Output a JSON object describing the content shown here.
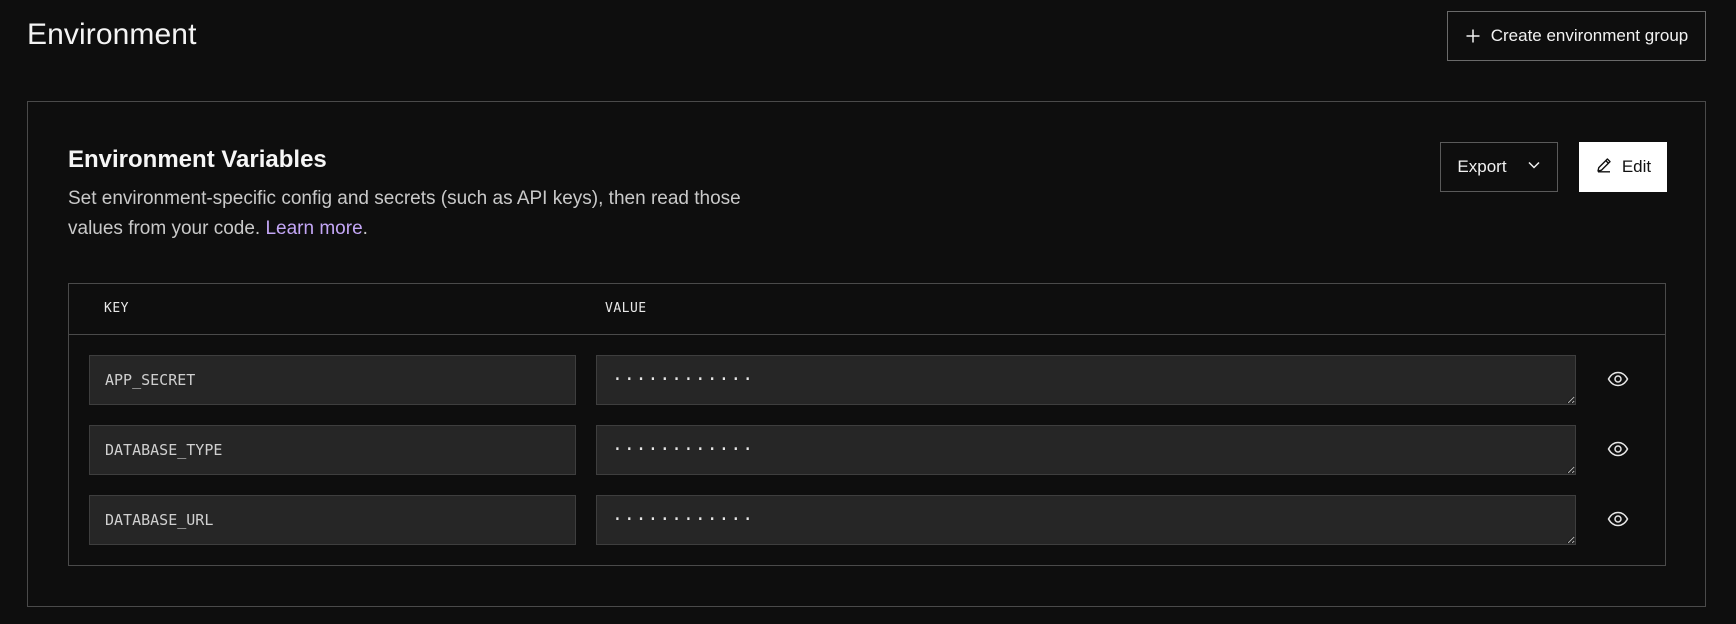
{
  "header": {
    "title": "Environment",
    "create_group_label": "Create environment group"
  },
  "card": {
    "title": "Environment Variables",
    "description": "Set environment-specific config and secrets (such as API keys), then read those values from your code.",
    "learn_more": "Learn more",
    "trailing": ".",
    "export_label": "Export",
    "edit_label": "Edit"
  },
  "table": {
    "columns": [
      "KEY",
      "VALUE"
    ],
    "rows": [
      {
        "key": "APP_SECRET",
        "value": "············"
      },
      {
        "key": "DATABASE_TYPE",
        "value": "············"
      },
      {
        "key": "DATABASE_URL",
        "value": "············"
      }
    ]
  },
  "colors": {
    "background": "#0e0e0e",
    "field": "#262626",
    "border": "#4a4a4a",
    "link": "#c3a6f5"
  },
  "icons": {
    "create": "plus-icon",
    "export": "chevron-down-icon",
    "edit": "pencil-icon",
    "reveal": "eye-icon"
  }
}
